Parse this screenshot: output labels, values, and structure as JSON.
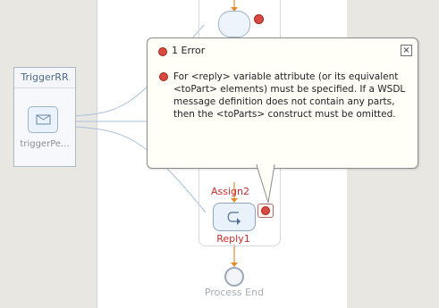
{
  "partner": {
    "title": "TriggerRR",
    "icon": "envelope-icon",
    "label": "triggerPe..."
  },
  "process": {
    "assign_label": "Assign2",
    "reply_label": "Reply1",
    "end_label": "Process End"
  },
  "tooltip": {
    "title": "1 Error",
    "close_icon": "close-icon",
    "message_lines": [
      "For <reply> variable attribute (or its equivalent",
      "<toPart> elements) must be specified. If a WSDL",
      "message definition does not contain any parts,",
      "then the <toParts> construct must be omitted."
    ]
  },
  "colors": {
    "error_red": "#d84a3f",
    "label_red": "#d02a2a",
    "flow_orange": "#e58a2b",
    "link_blue": "#a9c1dc"
  }
}
